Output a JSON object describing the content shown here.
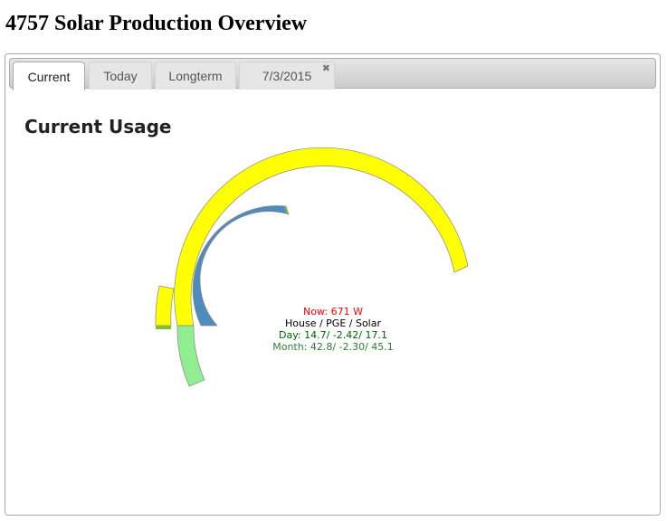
{
  "page": {
    "title": "4757 Solar Production Overview"
  },
  "tabs": [
    {
      "label": "Current",
      "active": true
    },
    {
      "label": "Today",
      "active": false
    },
    {
      "label": "Longterm",
      "active": false
    },
    {
      "label": "7/3/2015",
      "active": false,
      "closable": true,
      "close_glyph": "✖"
    }
  ],
  "section": {
    "title": "Current Usage"
  },
  "gauge": {
    "now": "Now: 671 W",
    "legend": "House / PGE / Solar",
    "day": "Day: 14.7/ -2.42/ 17.1",
    "month": "Month: 42.8/ -2.30/ 45.1",
    "colors": {
      "now": "#ff0000",
      "legend": "#000000",
      "day": "#006400",
      "month": "#2e7d32",
      "solar_arc": "#ffff00",
      "house_arc": "#4f8cbe",
      "pge_arc": "#90ee90",
      "small_yellow_arc": "#ffff00",
      "arc_stroke": "#888888"
    }
  }
}
